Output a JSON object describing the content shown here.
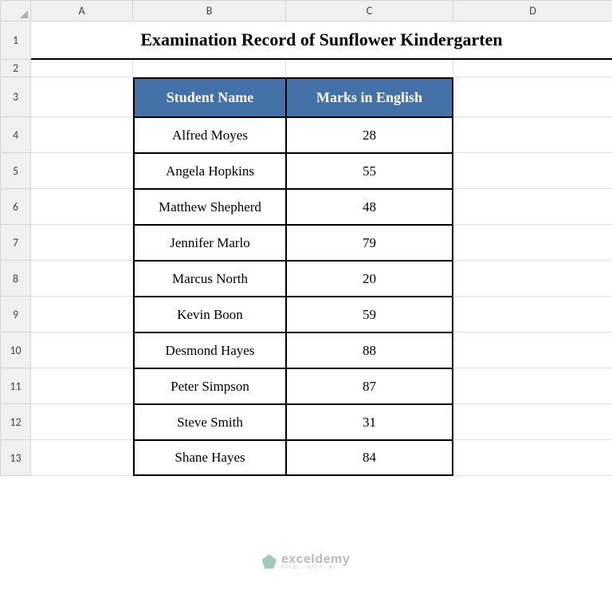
{
  "columns": [
    "A",
    "B",
    "C",
    "D"
  ],
  "row_numbers": [
    "1",
    "2",
    "3",
    "4",
    "5",
    "6",
    "7",
    "8",
    "9",
    "10",
    "11",
    "12",
    "13"
  ],
  "title": "Examination Record of Sunflower Kindergarten",
  "table": {
    "headers": [
      "Student Name",
      "Marks in English"
    ],
    "rows": [
      {
        "name": "Alfred Moyes",
        "marks": "28"
      },
      {
        "name": "Angela Hopkins",
        "marks": "55"
      },
      {
        "name": "Matthew Shepherd",
        "marks": "48"
      },
      {
        "name": "Jennifer Marlo",
        "marks": "79"
      },
      {
        "name": "Marcus North",
        "marks": "20"
      },
      {
        "name": "Kevin Boon",
        "marks": "59"
      },
      {
        "name": "Desmond Hayes",
        "marks": "88"
      },
      {
        "name": "Peter Simpson",
        "marks": "87"
      },
      {
        "name": "Steve Smith",
        "marks": "31"
      },
      {
        "name": "Shane Hayes",
        "marks": "84"
      }
    ]
  },
  "watermark": {
    "name": "exceldemy",
    "sub": "EXCEL · DATA · BI"
  }
}
